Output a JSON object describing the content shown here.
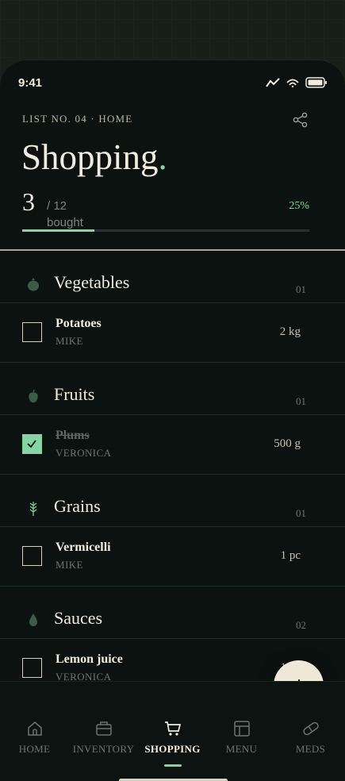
{
  "status": {
    "time": "9:41"
  },
  "header": {
    "kicker": "LIST NO. 04 · HOME",
    "title": "Shopping",
    "title_dot": ".",
    "bought_count": "3",
    "total": "/ 12",
    "bought_label": "bought",
    "percent_label": "25%",
    "progress": 0.25
  },
  "categories": [
    {
      "name": "Vegetables",
      "num": "01",
      "icon": "eggplant-icon",
      "items": [
        {
          "name": "Potatoes",
          "who": "MIKE",
          "qty": "2 kg",
          "checked": false
        }
      ]
    },
    {
      "name": "Fruits",
      "num": "01",
      "icon": "apple-icon",
      "items": [
        {
          "name": "Plums",
          "who": "VERONICA",
          "qty": "500 g",
          "checked": true
        }
      ]
    },
    {
      "name": "Grains",
      "num": "01",
      "icon": "wheat-icon",
      "items": [
        {
          "name": "Vermicelli",
          "who": "MIKE",
          "qty": "1 pc",
          "checked": false
        }
      ]
    },
    {
      "name": "Sauces",
      "num": "02",
      "icon": "drop-icon",
      "items": [
        {
          "name": "Lemon juice",
          "who": "VERONICA",
          "qty": "1 pc",
          "checked": false
        }
      ]
    }
  ],
  "nav": [
    {
      "label": "HOME",
      "icon": "home-icon",
      "active": false
    },
    {
      "label": "INVENTORY",
      "icon": "box-icon",
      "active": false
    },
    {
      "label": "SHOPPING",
      "icon": "cart-icon",
      "active": true
    },
    {
      "label": "MENU",
      "icon": "menu-grid-icon",
      "active": false
    },
    {
      "label": "MEDS",
      "icon": "pill-icon",
      "active": false
    }
  ],
  "colors": {
    "accent": "#86d3a3",
    "background": "#0c1210",
    "text": "#f1ece0"
  }
}
